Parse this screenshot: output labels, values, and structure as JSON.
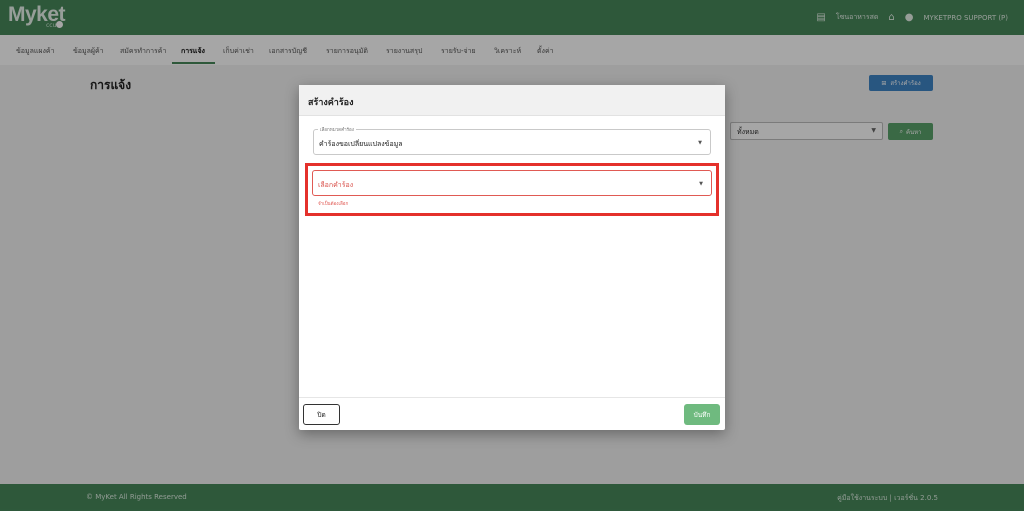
{
  "app": {
    "logo": "Myket",
    "logo_sub": "ccu",
    "top_links": [
      {
        "icon": "store-icon",
        "label": "โซนอาหารสด"
      },
      {
        "icon": "home-icon",
        "label": ""
      },
      {
        "icon": "user-icon",
        "label": "MYKETPRO SUPPORT (P)"
      }
    ]
  },
  "nav": {
    "items": [
      {
        "label": "ข้อมูลแผงค้า",
        "active": false
      },
      {
        "label": "ข้อมูลผู้ค้า",
        "active": false
      },
      {
        "label": "สมัครทำการค้า",
        "active": false
      },
      {
        "label": "การแจ้ง",
        "active": true
      },
      {
        "label": "เก็บค่าเช่า",
        "active": false
      },
      {
        "label": "เอกสารบัญชี",
        "active": false
      },
      {
        "label": "รายการอนุมัติ",
        "active": false
      },
      {
        "label": "รายงานสรุป",
        "active": false
      },
      {
        "label": "รายรับ-จ่าย",
        "active": false
      },
      {
        "label": "วิเคราะห์",
        "active": false
      },
      {
        "label": "ตั้งค่า",
        "active": false
      }
    ]
  },
  "page": {
    "title": "การแจ้ง",
    "create_button": "สร้างคำร้อง",
    "filter_value": "ทั้งหมด",
    "search_button": "ค้นหา"
  },
  "modal": {
    "title": "สร้างคำร้อง",
    "category_label": "เลือกหมวดคำร้อง",
    "category_value": "คำร้องขอเปลี่ยนแปลงข้อมูล",
    "request_placeholder": "เลือกคำร้อง",
    "required_message": "จำเป็นต้องเลือก",
    "close_button": "ปิด",
    "save_button": "บันทึก"
  },
  "footer": {
    "copyright": "© MyKet All Rights Reserved",
    "version": "คู่มือใช้งานระบบ | เวอร์ชั่น 2.0.5"
  },
  "colors": {
    "brand": "#47885a",
    "primary_blue": "#3e84c5",
    "error": "#e4312b",
    "save_green": "#6fba7f"
  }
}
